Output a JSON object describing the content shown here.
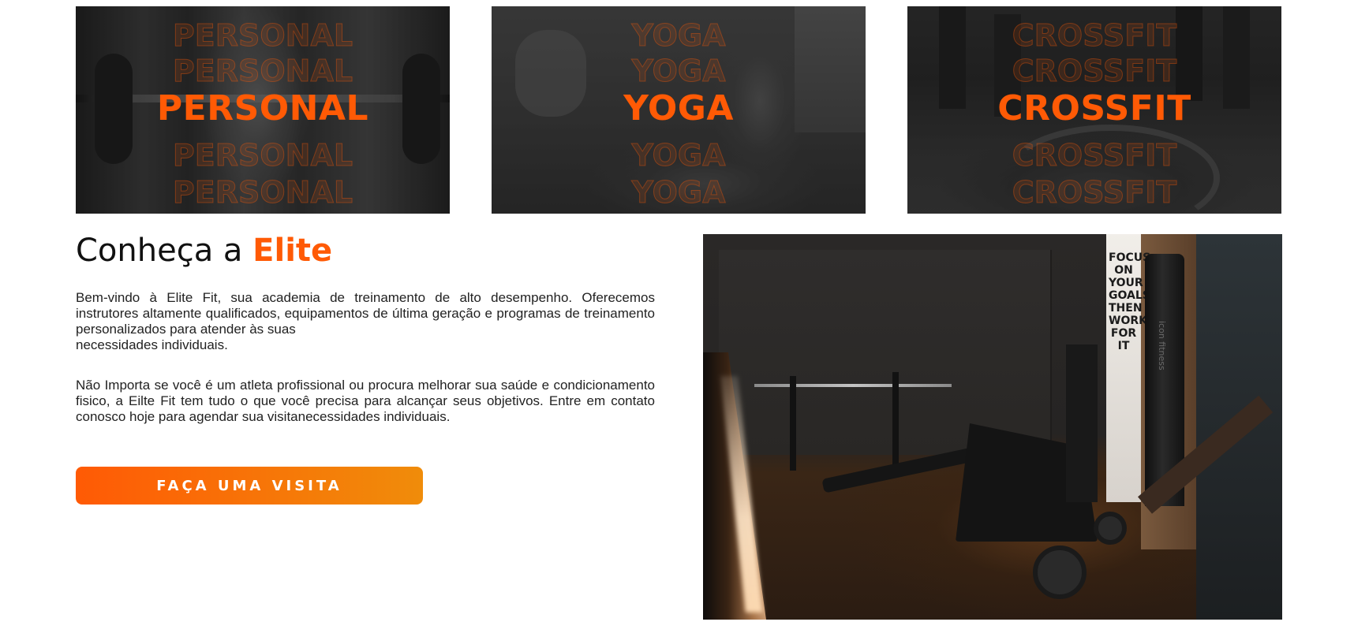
{
  "categories": [
    {
      "label": "PERSONAL"
    },
    {
      "label": "YOGA"
    },
    {
      "label": "CROSSFIT"
    }
  ],
  "about": {
    "title_prefix": "Conheça a",
    "title_accent": "Elite",
    "paragraph1_lines": [
      "Bem-vindo à Elite Fit, sua academia de treinamento de alto desempenho. Oferecemos instrutores altamente qualificados, equipamentos de última geração e programas de treinamento personalizados para atender às suas",
      "necessidades individuais."
    ],
    "paragraph2": "Não Importa se você é um atleta profissional ou procura melhorar sua saúde e condicionamento fisico, a Eilte Fit tem tudo o que você precisa para alcançar seus objetivos. Entre em contato conosco hoje para agendar sua visitanecessidades individuais.",
    "button_label": "FAÇA UMA VISITA"
  },
  "gym_image": {
    "poster_text": "FOCUS ON YOUR GOALS THEN WORK FOR IT",
    "machine_label": "icon fitness"
  },
  "colors": {
    "accent": "#ff5a05",
    "button_gradient_start": "#ff5a05",
    "button_gradient_end": "#f08c0a",
    "text_dark": "#111111"
  }
}
